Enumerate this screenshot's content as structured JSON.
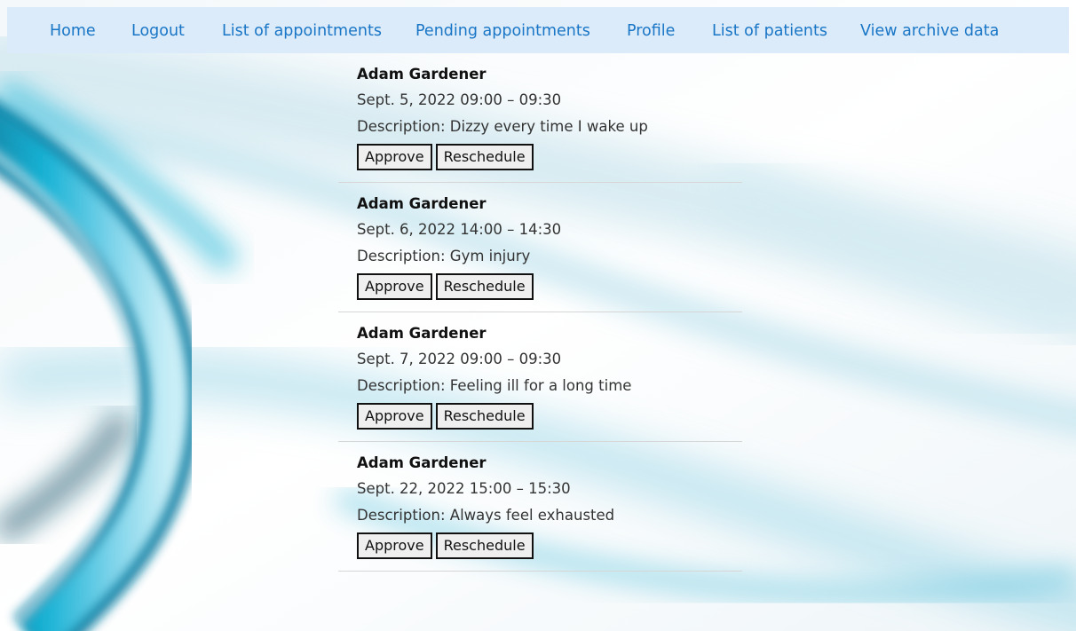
{
  "nav": [
    {
      "label": "Home"
    },
    {
      "label": "Logout"
    },
    {
      "label": "List of appointments"
    },
    {
      "label": "Pending appointments"
    },
    {
      "label": "Profile"
    },
    {
      "label": "List of patients"
    },
    {
      "label": "View archive data"
    }
  ],
  "appointments": [
    {
      "patient": "Adam Gardener",
      "datetime": "Sept. 5, 2022 09:00 – 09:30",
      "description": "Description: Dizzy every time I wake up",
      "approve_label": "Approve",
      "reschedule_label": "Reschedule"
    },
    {
      "patient": "Adam Gardener",
      "datetime": "Sept. 6, 2022 14:00 – 14:30",
      "description": "Description: Gym injury",
      "approve_label": "Approve",
      "reschedule_label": "Reschedule"
    },
    {
      "patient": "Adam Gardener",
      "datetime": "Sept. 7, 2022 09:00 – 09:30",
      "description": "Description: Feeling ill for a long time",
      "approve_label": "Approve",
      "reschedule_label": "Reschedule"
    },
    {
      "patient": "Adam Gardener",
      "datetime": "Sept. 22, 2022 15:00 – 15:30",
      "description": "Description: Always feel exhausted",
      "approve_label": "Approve",
      "reschedule_label": "Reschedule"
    }
  ],
  "colors": {
    "nav_background": "#dcebf9",
    "nav_link": "#1976c6",
    "background_accent": "#1aa7c9"
  }
}
